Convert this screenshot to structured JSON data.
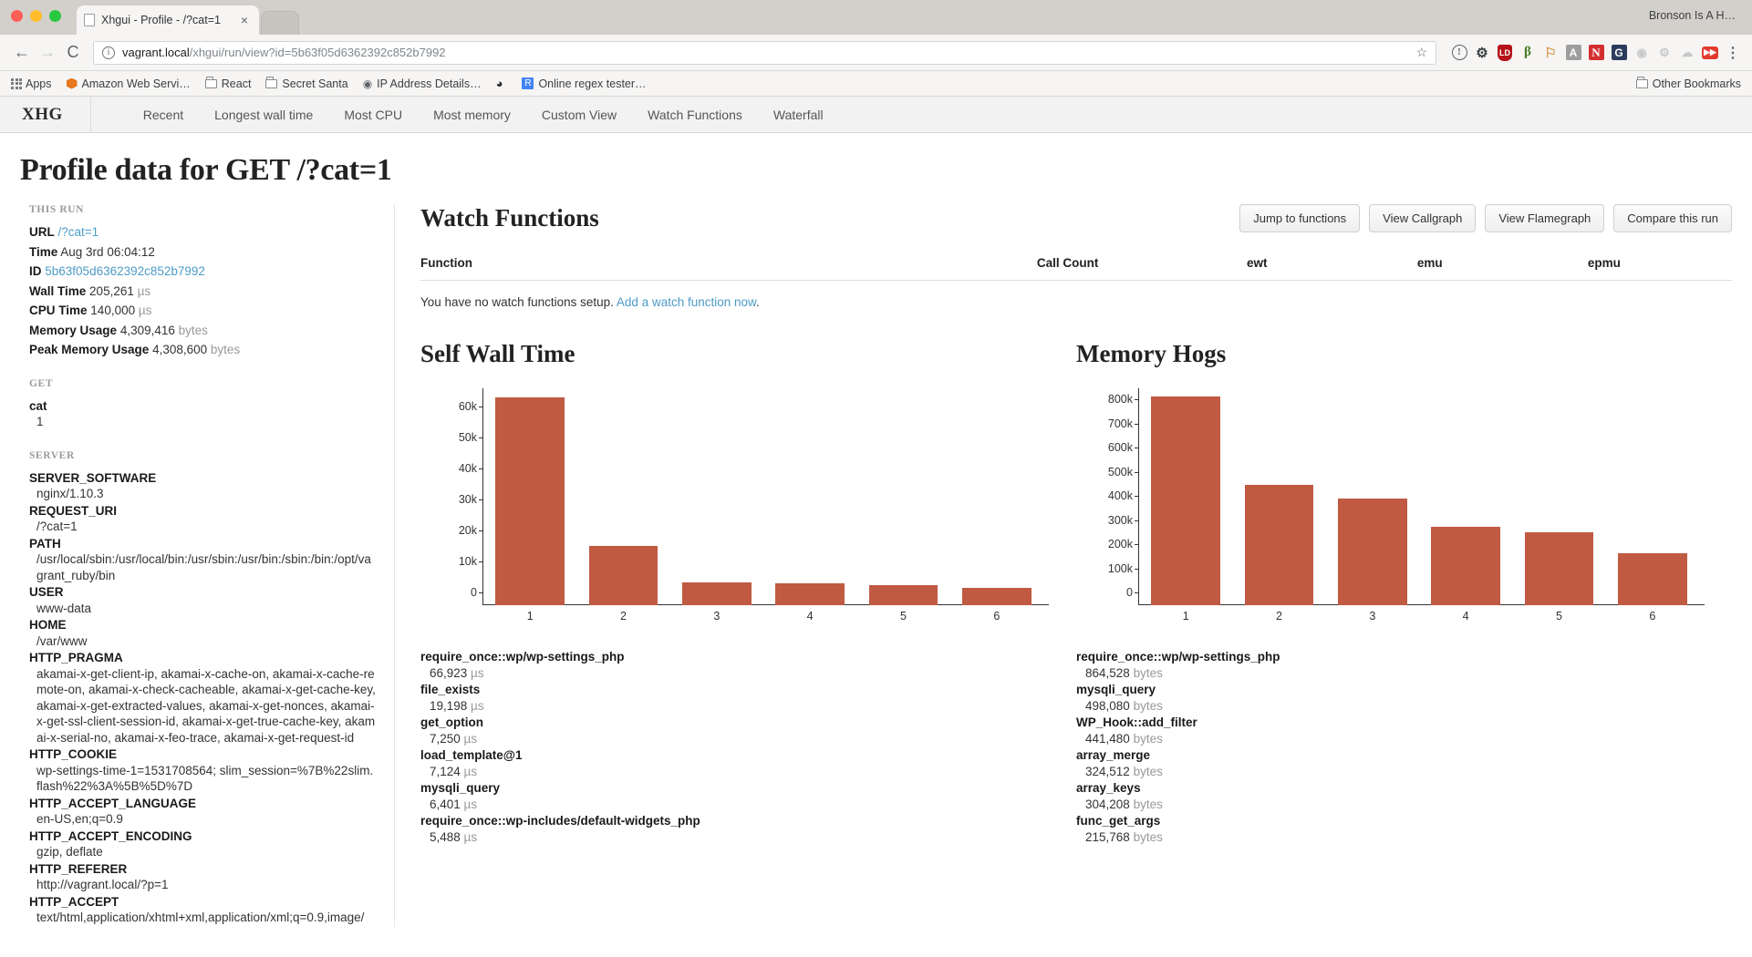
{
  "browser": {
    "tab_title": "Xhgui - Profile - /?cat=1",
    "tab_close": "×",
    "window_user": "Bronson Is A H…",
    "back_icon": "←",
    "forward_icon": "→",
    "reload_icon": "C",
    "url_host": "vagrant.local",
    "url_path": "/xhgui/run/view?id=5b63f05d6362392c852b7992",
    "star_icon": "☆",
    "menu_icon": "⋮",
    "extensions": [
      "info-circle-icon",
      "gear-icon",
      "lastpass-shield-icon",
      "buffer-icon",
      "flag-icon",
      "grammarly-icon",
      "evernote-icon",
      "google-icon",
      "faded-icon-1",
      "faded-icon-2",
      "faded-icon-3",
      "youtube-icon"
    ],
    "bookmarks": [
      {
        "label": "Apps",
        "icon": "apps-grid-icon"
      },
      {
        "label": "Amazon Web Servi…",
        "icon": "aws-icon"
      },
      {
        "label": "React",
        "icon": "folder-icon"
      },
      {
        "label": "Secret Santa",
        "icon": "folder-icon"
      },
      {
        "label": "IP Address Details…",
        "icon": "pin-icon"
      },
      {
        "label": "",
        "icon": "github-icon"
      },
      {
        "label": "Online regex tester…",
        "icon": "r-icon"
      }
    ],
    "other_bookmarks": "Other Bookmarks"
  },
  "app": {
    "brand": "XHG",
    "nav": [
      {
        "label": "Recent"
      },
      {
        "label": "Longest wall time"
      },
      {
        "label": "Most CPU"
      },
      {
        "label": "Most memory"
      },
      {
        "label": "Custom View"
      },
      {
        "label": "Watch Functions"
      },
      {
        "label": "Waterfall"
      }
    ],
    "page_title": "Profile data for GET /?cat=1"
  },
  "sidebar": {
    "this_run_heading": "THIS RUN",
    "url_label": "URL",
    "url_value": "/?cat=1",
    "time_label": "Time",
    "time_value": "Aug 3rd 06:04:12",
    "id_label": "ID",
    "id_value": "5b63f05d6362392c852b7992",
    "wall_label": "Wall Time",
    "wall_value": "205,261",
    "wall_unit": "µs",
    "cpu_label": "CPU Time",
    "cpu_value": "140,000",
    "cpu_unit": "µs",
    "mem_label": "Memory Usage",
    "mem_value": "4,309,416",
    "mem_unit": "bytes",
    "peak_label": "Peak Memory Usage",
    "peak_value": "4,308,600",
    "peak_unit": "bytes",
    "get_heading": "GET",
    "get_params": [
      {
        "key": "cat",
        "value": "1"
      }
    ],
    "server_heading": "SERVER",
    "server_vars": [
      {
        "key": "SERVER_SOFTWARE",
        "value": "nginx/1.10.3"
      },
      {
        "key": "REQUEST_URI",
        "value": "/?cat=1"
      },
      {
        "key": "PATH",
        "value": "/usr/local/sbin:/usr/local/bin:/usr/sbin:/usr/bin:/sbin:/bin:/opt/vagrant_ruby/bin"
      },
      {
        "key": "USER",
        "value": "www-data"
      },
      {
        "key": "HOME",
        "value": "/var/www"
      },
      {
        "key": "HTTP_PRAGMA",
        "value": "akamai-x-get-client-ip, akamai-x-cache-on, akamai-x-cache-remote-on, akamai-x-check-cacheable, akamai-x-get-cache-key, akamai-x-get-extracted-values, akamai-x-get-nonces, akamai-x-get-ssl-client-session-id, akamai-x-get-true-cache-key, akamai-x-serial-no, akamai-x-feo-trace, akamai-x-get-request-id"
      },
      {
        "key": "HTTP_COOKIE",
        "value": "wp-settings-time-1=1531708564; slim_session=%7B%22slim.flash%22%3A%5B%5D%7D"
      },
      {
        "key": "HTTP_ACCEPT_LANGUAGE",
        "value": "en-US,en;q=0.9"
      },
      {
        "key": "HTTP_ACCEPT_ENCODING",
        "value": "gzip, deflate"
      },
      {
        "key": "HTTP_REFERER",
        "value": "http://vagrant.local/?p=1"
      },
      {
        "key": "HTTP_ACCEPT",
        "value": "text/html,application/xhtml+xml,application/xml;q=0.9,image/"
      }
    ]
  },
  "watch": {
    "title": "Watch Functions",
    "buttons": [
      {
        "label": "Jump to functions"
      },
      {
        "label": "View Callgraph"
      },
      {
        "label": "View Flamegraph"
      },
      {
        "label": "Compare this run"
      }
    ],
    "columns": [
      "Function",
      "Call Count",
      "ewt",
      "emu",
      "epmu"
    ],
    "empty_text": "You have no watch functions setup.",
    "empty_link": "Add a watch function now",
    "empty_period": "."
  },
  "chart_data": [
    {
      "type": "bar",
      "title": "Self Wall Time",
      "categories": [
        "1",
        "2",
        "3",
        "4",
        "5",
        "6"
      ],
      "values": [
        66923,
        19198,
        7250,
        7124,
        6401,
        5488
      ],
      "labels": [
        "require_once::wp/wp-settings_php",
        "file_exists",
        "get_option",
        "load_template@1",
        "mysqli_query",
        "require_once::wp-includes/default-widgets_php"
      ],
      "value_strings": [
        "66,923",
        "19,198",
        "7,250",
        "7,124",
        "6,401",
        "5,488"
      ],
      "unit": "µs",
      "yticks": [
        "0",
        "10k",
        "20k",
        "30k",
        "40k",
        "50k",
        "60k"
      ],
      "ytick_values": [
        0,
        10000,
        20000,
        30000,
        40000,
        50000,
        60000
      ],
      "ylim": [
        0,
        70000
      ],
      "xlabel": "",
      "ylabel": "",
      "grid": false,
      "bar_color": "#c05a43"
    },
    {
      "type": "bar",
      "title": "Memory Hogs",
      "categories": [
        "1",
        "2",
        "3",
        "4",
        "5",
        "6"
      ],
      "values": [
        864528,
        498080,
        441480,
        324512,
        304208,
        215768
      ],
      "labels": [
        "require_once::wp/wp-settings_php",
        "mysqli_query",
        "WP_Hook::add_filter",
        "array_merge",
        "array_keys",
        "func_get_args"
      ],
      "value_strings": [
        "864,528",
        "498,080",
        "441,480",
        "324,512",
        "304,208",
        "215,768"
      ],
      "unit": "bytes",
      "yticks": [
        "0",
        "100k",
        "200k",
        "300k",
        "400k",
        "500k",
        "600k",
        "700k",
        "800k"
      ],
      "ytick_values": [
        0,
        100000,
        200000,
        300000,
        400000,
        500000,
        600000,
        700000,
        800000
      ],
      "ylim": [
        0,
        900000
      ],
      "xlabel": "",
      "ylabel": "",
      "grid": false,
      "bar_color": "#c05a43"
    }
  ]
}
